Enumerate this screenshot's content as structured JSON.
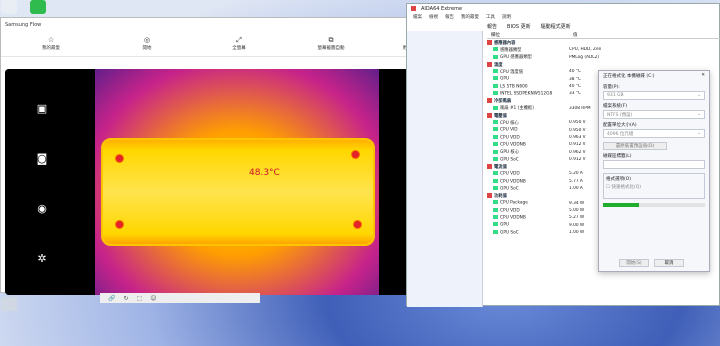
{
  "samsung_flow": {
    "title": "Samsung Flow",
    "toolbar": [
      {
        "icon": "star-icon",
        "glyph": "☆",
        "label": "我的最愛"
      },
      {
        "icon": "record-icon",
        "glyph": "◎",
        "label": "開始"
      },
      {
        "icon": "fullscreen-icon",
        "glyph": "⤢",
        "label": "全螢幕"
      },
      {
        "icon": "lock-icon",
        "glyph": "⧉",
        "label": "螢幕截圖自動"
      },
      {
        "icon": "more-icon",
        "glyph": "⋮",
        "label": "更多"
      }
    ],
    "window_controls": [
      "—",
      "☐",
      "✕"
    ],
    "thermal_readout": "48.3°C",
    "left_camera_icons": [
      "gallery-icon",
      "camera-icon",
      "shutter-icon",
      "aperture-icon"
    ],
    "right_camera_icons": [
      "hdr-icon",
      "leaf-icon",
      "flash-icon",
      "settings-icon"
    ],
    "bottom_icons": [
      "🔗",
      "↻",
      "⬚",
      "☺"
    ]
  },
  "aida64": {
    "title": "AIDA64 Extreme",
    "menu": [
      "檔案",
      "檢視",
      "報告",
      "我的最愛",
      "工具",
      "說明"
    ],
    "toolbar": [
      "報告",
      "BIOS 更新",
      "驅動程式更新"
    ],
    "columns": [
      "欄位",
      "值"
    ],
    "rows": [
      {
        "section": true,
        "k": "感應器內容",
        "v": ""
      },
      {
        "k": "感應器類型",
        "v": "CPU, HDD, Zen"
      },
      {
        "k": "GPU 感應器類型",
        "v": "PMLog (ADL2)"
      },
      {
        "section": true,
        "k": "溫度",
        "v": ""
      },
      {
        "k": "CPU 溫度值",
        "v": "40 °C"
      },
      {
        "k": "GPU",
        "v": "38 °C"
      },
      {
        "k": "LS 5TB N600",
        "v": "40 °C"
      },
      {
        "k": "INTEL SSDPEKNW512G8",
        "v": "33 °C"
      },
      {
        "section": true,
        "k": "冷卻風扇",
        "v": ""
      },
      {
        "k": "風扇 #1 (主機板)",
        "v": "3308 RPM"
      },
      {
        "section": true,
        "k": "電壓值",
        "v": ""
      },
      {
        "k": "CPU 核心",
        "v": "0.950 V"
      },
      {
        "k": "CPU VID",
        "v": "0.950 V"
      },
      {
        "k": "CPU VDD",
        "v": "0.963 V"
      },
      {
        "k": "CPU VDDNB",
        "v": "0.912 V"
      },
      {
        "k": "GPU 核心",
        "v": "0.962 V"
      },
      {
        "k": "GPU SoC",
        "v": "0.912 V"
      },
      {
        "section": true,
        "k": "電流值",
        "v": ""
      },
      {
        "k": "CPU VDD",
        "v": "5.20 A"
      },
      {
        "k": "CPU VDDNB",
        "v": "5.77 A"
      },
      {
        "k": "GPU SoC",
        "v": "1.00 A"
      },
      {
        "section": true,
        "k": "功耗值",
        "v": ""
      },
      {
        "k": "CPU Package",
        "v": "9.34 W"
      },
      {
        "k": "CPU VDD",
        "v": "5.00 W"
      },
      {
        "k": "CPU VDDNB",
        "v": "5.27 W"
      },
      {
        "k": "GPU",
        "v": "9.00 W"
      },
      {
        "k": "GPU SoC",
        "v": "1.00 W"
      }
    ]
  },
  "format_dialog": {
    "title": "正在格式化 本機磁碟 (C:)",
    "capacity_label": "容量(P):",
    "capacity_value": "931 GB",
    "filesystem_label": "檔案系統(F)",
    "filesystem_value": "NTFS (預設)",
    "alloc_label": "配置單位大小(A)",
    "alloc_value": "4096 位元組",
    "restore_button": "還原裝置預設值(D)",
    "volume_label": "磁碟區標籤(L)",
    "options_label": "格式選項(O)",
    "quick_format": "快速格式化(Q)",
    "progress": 0.35,
    "start_button": "開始(S)",
    "close_button": "取消"
  }
}
